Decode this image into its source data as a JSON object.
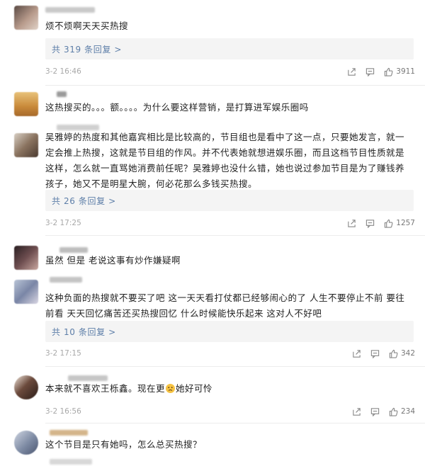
{
  "comments": [
    {
      "text": "烦不烦啊天天买热搜",
      "replies_label": "共 319 条回复 >",
      "time": "3-2 16:46",
      "likes": "3911"
    },
    {
      "text": "这热搜买的。。。额。。。。为什么要这样营销，是打算进军娱乐圈吗"
    },
    {
      "text": "吴雅婷的热度和其他嘉宾相比是比较高的，节目组也是看中了这一点，只要她发言，就一定会推上热搜，这就是节目组的作风。并不代表她就想进娱乐圈，而且这档节目性质就是这样，怎么就一直骂她消费前任呢？吴雅婷也没什么错，她也说过参加节目是为了赚钱养孩子，她又不是明星大腕，何必花那么多钱买热搜。",
      "replies_label": "共 26 条回复 >",
      "time": "3-2 17:25",
      "likes": "1257"
    },
    {
      "text": "虽然 但是 老说这事有炒作嫌疑啊"
    },
    {
      "text": "这种负面的热搜就不要买了吧 这一天天看打仗都已经够闹心的了 人生不要停止不前 要往前看 天天回忆痛苦还买热搜回忆 什么时候能快乐起来 这对人不好吧",
      "replies_label": "共 10 条回复 >",
      "time": "3-2 17:15",
      "likes": "342"
    },
    {
      "text_before": "本来就不喜欢王栎鑫。现在更",
      "text_after": "她好可怜",
      "time": "3-2 16:56",
      "likes": "234"
    },
    {
      "text": "这个节目是只有她吗，怎么总买热搜？"
    }
  ],
  "icons": {
    "share": "share-icon",
    "comment": "comment-icon",
    "like": "thumbs-up-icon",
    "emoji": "sad-face-emoji-icon"
  },
  "colors": {
    "link": "#5d7ea8",
    "meta": "#a8a8a8",
    "text": "#222222",
    "reply_bg": "#f4f4f4"
  }
}
